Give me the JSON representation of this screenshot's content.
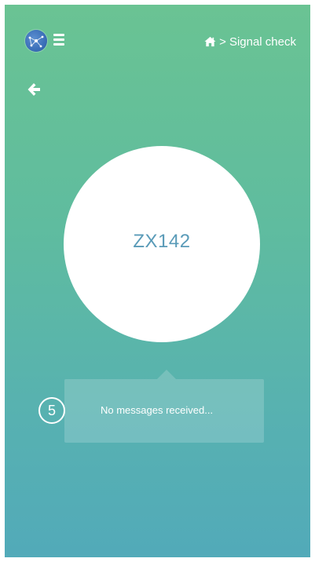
{
  "header": {
    "logo_icon": "globe-network-icon",
    "menu_icon": "hamburger-menu-icon",
    "breadcrumb": {
      "home_icon": "home-icon",
      "separator": ">",
      "current": "Signal check"
    }
  },
  "nav": {
    "back_icon": "arrow-left-icon"
  },
  "device": {
    "id": "ZX142"
  },
  "status": {
    "message": "No messages received..."
  },
  "annotation": {
    "step_number": "5"
  },
  "colors": {
    "gradient_top": "#6ac393",
    "gradient_bottom": "#52aab9",
    "device_id_text": "#5a9bb8",
    "logo_blue": "#3b6fb8"
  }
}
